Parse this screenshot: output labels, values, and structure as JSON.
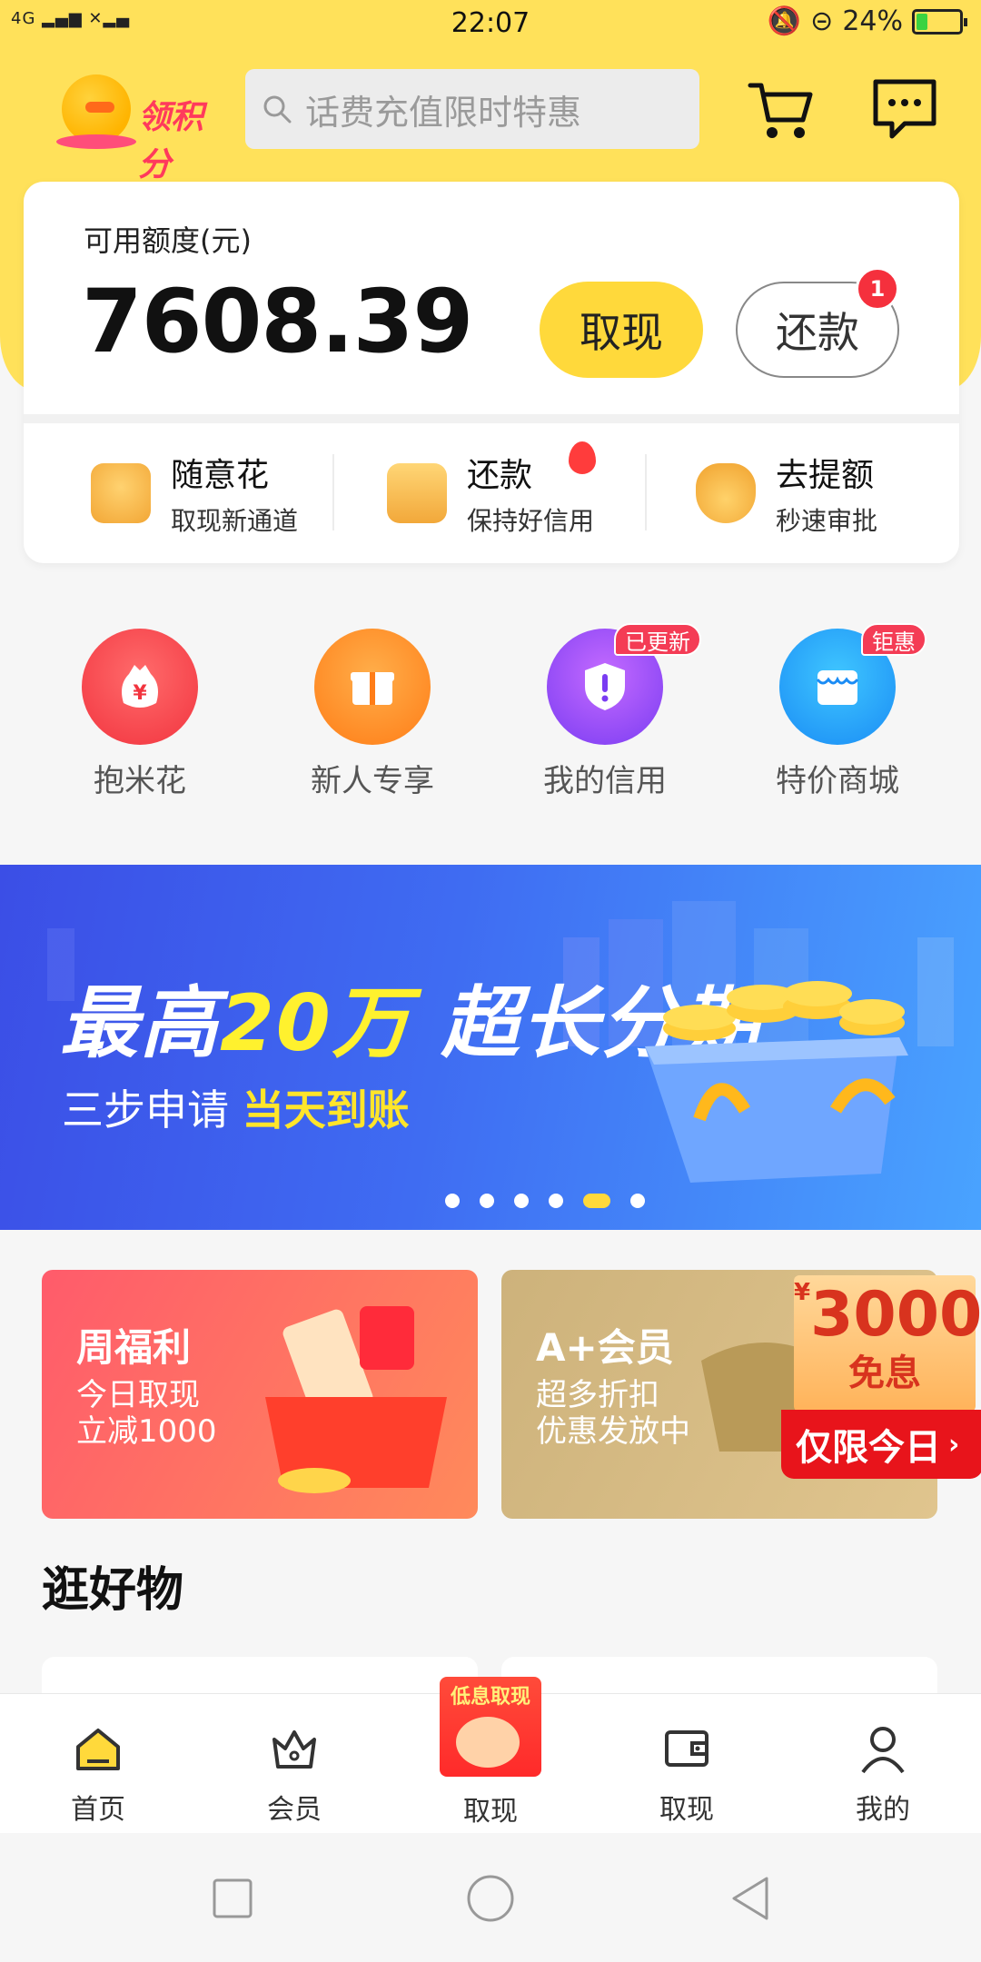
{
  "status_bar": {
    "time": "22:07",
    "network": "4G",
    "battery": "24%"
  },
  "header": {
    "logo_text": "领积分",
    "search_placeholder": "话费充值限时特惠"
  },
  "balance_card": {
    "label": "可用额度(元)",
    "amount": "7608.39",
    "withdraw_label": "取现",
    "repay_label": "还款",
    "repay_badge": "1"
  },
  "quick_actions": [
    {
      "title": "随意花",
      "subtitle": "取现新通道"
    },
    {
      "title": "还款",
      "subtitle": "保持好信用"
    },
    {
      "title": "去提额",
      "subtitle": "秒速审批"
    }
  ],
  "features": [
    {
      "label": "抱米花",
      "tag": ""
    },
    {
      "label": "新人专享",
      "tag": ""
    },
    {
      "label": "我的信用",
      "tag": "已更新"
    },
    {
      "label": "特价商城",
      "tag": "钜惠"
    }
  ],
  "banner": {
    "title_a": "最高",
    "title_b": "20万",
    "title_c": "超长分期",
    "sub_a": "三步申请",
    "sub_b": "当天到账",
    "pages": 6,
    "active_page": 5
  },
  "promos": [
    {
      "title": "周福利",
      "line1": "今日取现",
      "line2": "立减1000"
    },
    {
      "title": "A+会员",
      "line1": "超多折扣",
      "line2": "优惠发放中"
    }
  ],
  "floating_ad": {
    "currency": "¥",
    "amount": "3000",
    "text": "免息",
    "cta": "仅限今日"
  },
  "section": {
    "title": "逛好物"
  },
  "tabbar": {
    "center_promo": "低息取现",
    "items": [
      {
        "label": "首页"
      },
      {
        "label": "会员"
      },
      {
        "label": "取现"
      },
      {
        "label": "取现"
      },
      {
        "label": "我的"
      }
    ]
  },
  "colors": {
    "accent_yellow": "#ffe15a",
    "button_yellow": "#ffd93b",
    "badge_red": "#f5303d"
  }
}
